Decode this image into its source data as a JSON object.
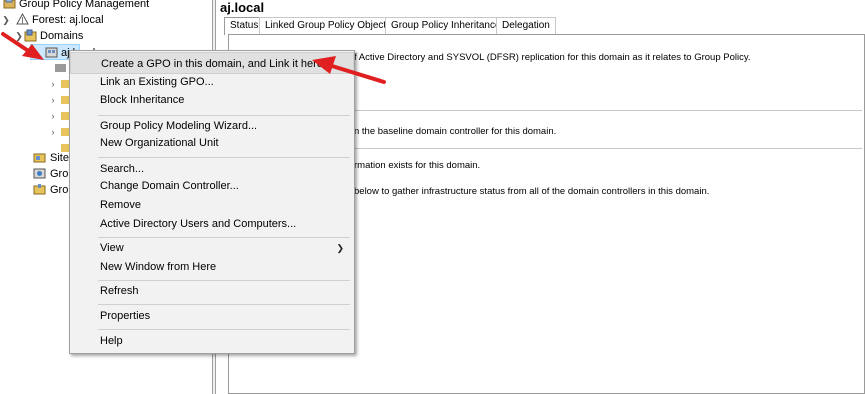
{
  "tree": {
    "items": [
      {
        "label": "Group Policy Management",
        "icon": "gpm-icon"
      },
      {
        "label": "Forest: aj.local",
        "icon": "forest-icon"
      },
      {
        "label": "Domains",
        "icon": "domains-icon"
      },
      {
        "label": "aj.local",
        "icon": "domain-icon"
      },
      {
        "label": "Sites",
        "icon": "sites-icon"
      },
      {
        "label": "Grou",
        "icon": "gpo-modeling-icon"
      },
      {
        "label": "Grou",
        "icon": "gpo-results-icon"
      }
    ]
  },
  "right": {
    "title": "aj.local",
    "tabs": [
      {
        "label": "Status"
      },
      {
        "label": "Linked Group Policy Objects"
      },
      {
        "label": "Group Policy Inheritance"
      },
      {
        "label": "Delegation"
      }
    ],
    "lines": [
      "f Active Directory and SYSVOL (DFSR) replication for this domain as it relates to Group Policy.",
      "n the baseline domain controller for this domain.",
      "rmation exists for this domain.",
      " below to gather infrastructure status from all of the domain controllers in this domain."
    ]
  },
  "menu": {
    "items": [
      {
        "label": "Create a GPO in this domain, and Link it here..."
      },
      {
        "label": "Link an Existing GPO..."
      },
      {
        "label": "Block Inheritance"
      },
      {
        "label": "Group Policy Modeling Wizard..."
      },
      {
        "label": "New Organizational Unit"
      },
      {
        "label": "Search..."
      },
      {
        "label": "Change Domain Controller..."
      },
      {
        "label": "Remove"
      },
      {
        "label": "Active Directory Users and Computers..."
      },
      {
        "label": "View"
      },
      {
        "label": "New Window from Here"
      },
      {
        "label": "Refresh"
      },
      {
        "label": "Properties"
      },
      {
        "label": "Help"
      }
    ]
  },
  "colors": {
    "annotation_arrow": "#e02020",
    "menu_background": "#f2f2f2",
    "highlight": "#e0e0e0"
  }
}
